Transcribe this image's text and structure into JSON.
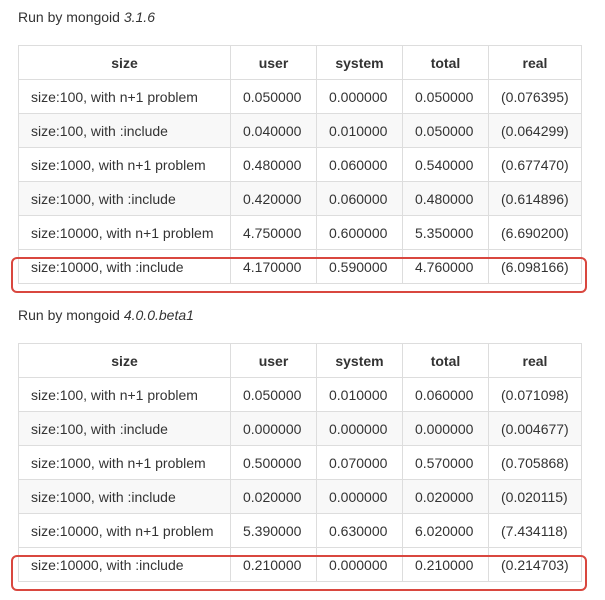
{
  "section1": {
    "caption_prefix": "Run by mongoid ",
    "caption_version": "3.1.6",
    "headers": [
      "size",
      "user",
      "system",
      "total",
      "real"
    ],
    "rows": [
      [
        "size:100, with n+1 problem",
        "0.050000",
        "0.000000",
        "0.050000",
        "(0.076395)"
      ],
      [
        "size:100, with :include",
        "0.040000",
        "0.010000",
        "0.050000",
        "(0.064299)"
      ],
      [
        "size:1000, with n+1 problem",
        "0.480000",
        "0.060000",
        "0.540000",
        "(0.677470)"
      ],
      [
        "size:1000, with :include",
        "0.420000",
        "0.060000",
        "0.480000",
        "(0.614896)"
      ],
      [
        "size:10000, with n+1 problem",
        "4.750000",
        "0.600000",
        "5.350000",
        "(6.690200)"
      ],
      [
        "size:10000, with :include",
        "4.170000",
        "0.590000",
        "4.760000",
        "(6.098166)"
      ]
    ]
  },
  "section2": {
    "caption_prefix": "Run by mongoid ",
    "caption_version": "4.0.0.beta1",
    "headers": [
      "size",
      "user",
      "system",
      "total",
      "real"
    ],
    "rows": [
      [
        "size:100, with n+1 problem",
        "0.050000",
        "0.010000",
        "0.060000",
        "(0.071098)"
      ],
      [
        "size:100, with :include",
        "0.000000",
        "0.000000",
        "0.000000",
        "(0.004677)"
      ],
      [
        "size:1000, with n+1 problem",
        "0.500000",
        "0.070000",
        "0.570000",
        "(0.705868)"
      ],
      [
        "size:1000, with :include",
        "0.020000",
        "0.000000",
        "0.020000",
        "(0.020115)"
      ],
      [
        "size:10000, with n+1 problem",
        "5.390000",
        "0.630000",
        "6.020000",
        "(7.434118)"
      ],
      [
        "size:10000, with :include",
        "0.210000",
        "0.000000",
        "0.210000",
        "(0.214703)"
      ]
    ]
  },
  "highlight_color": "#d9473f"
}
